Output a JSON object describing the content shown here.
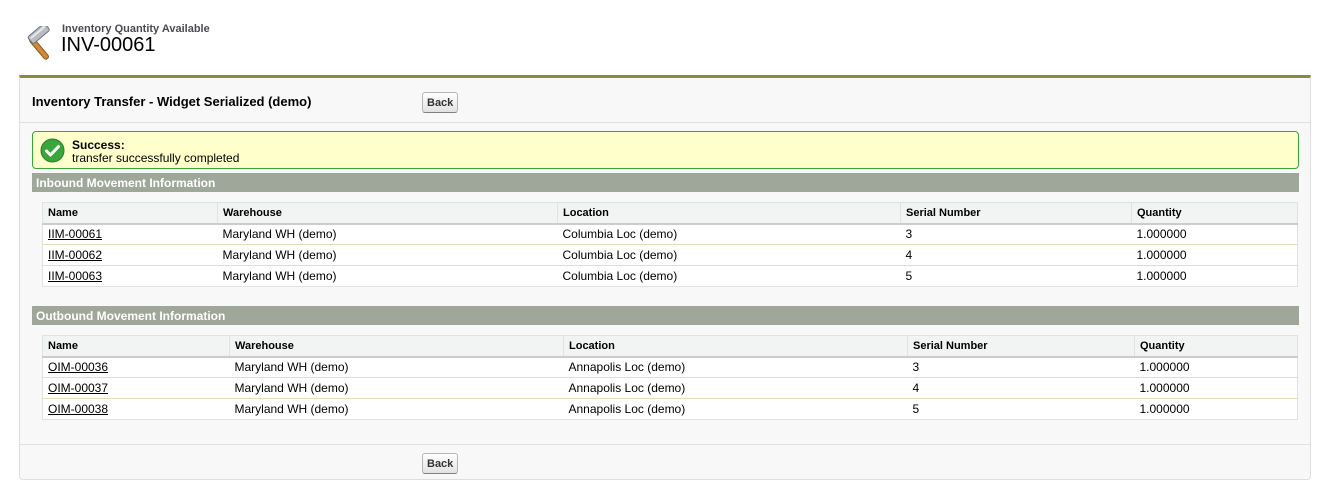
{
  "header": {
    "subtitle": "Inventory Quantity Available",
    "title": "INV-00061",
    "icon": "hammer-icon"
  },
  "panel": {
    "title": "Inventory Transfer - Widget Serialized (demo)",
    "back_label": "Back"
  },
  "message": {
    "icon": "check-circle-icon",
    "title": "Success:",
    "text": "transfer successfully completed"
  },
  "colors": {
    "section_header": "#9fa79a",
    "panel_border_top": "#8a8a3c",
    "message_bg": "#ffffcc",
    "message_border": "#39a539"
  },
  "inbound": {
    "title": "Inbound Movement Information",
    "columns": [
      "Name",
      "Warehouse",
      "Location",
      "Serial Number",
      "Quantity"
    ],
    "rows": [
      [
        "IIM-00061",
        "Maryland WH (demo)",
        "Columbia Loc (demo)",
        "3",
        "1.000000"
      ],
      [
        "IIM-00062",
        "Maryland WH (demo)",
        "Columbia Loc (demo)",
        "4",
        "1.000000"
      ],
      [
        "IIM-00063",
        "Maryland WH (demo)",
        "Columbia Loc (demo)",
        "5",
        "1.000000"
      ]
    ]
  },
  "outbound": {
    "title": "Outbound Movement Information",
    "columns": [
      "Name",
      "Warehouse",
      "Location",
      "Serial Number",
      "Quantity"
    ],
    "rows": [
      [
        "OIM-00036",
        "Maryland WH (demo)",
        "Annapolis Loc (demo)",
        "3",
        "1.000000"
      ],
      [
        "OIM-00037",
        "Maryland WH (demo)",
        "Annapolis Loc (demo)",
        "4",
        "1.000000"
      ],
      [
        "OIM-00038",
        "Maryland WH (demo)",
        "Annapolis Loc (demo)",
        "5",
        "1.000000"
      ]
    ]
  }
}
